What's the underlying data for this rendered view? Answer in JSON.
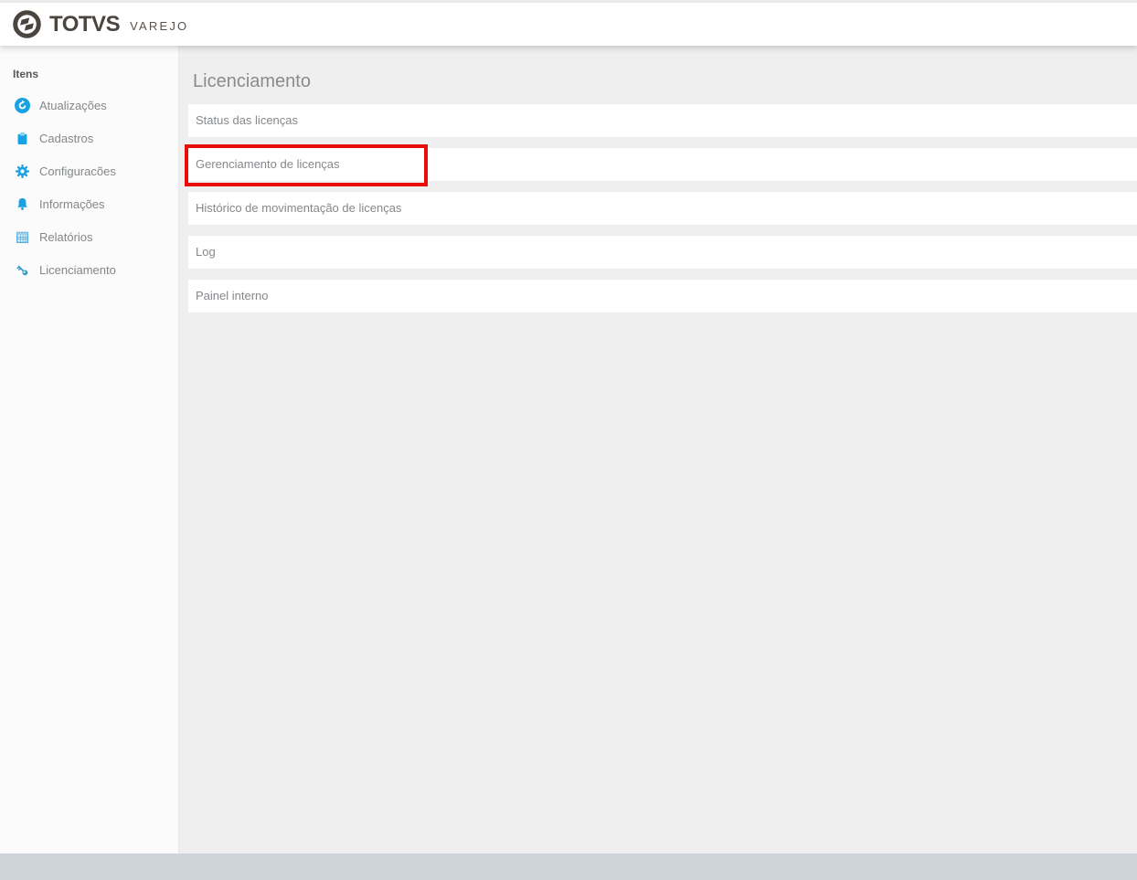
{
  "header": {
    "brand": "TOTVS",
    "brand_suffix": "VAREJO"
  },
  "sidebar": {
    "title": "Itens",
    "items": [
      {
        "label": "Atualizações",
        "icon": "sync-icon"
      },
      {
        "label": "Cadastros",
        "icon": "clipboard-icon"
      },
      {
        "label": "Configuracões",
        "icon": "gear-icon"
      },
      {
        "label": "Informações",
        "icon": "bell-icon"
      },
      {
        "label": "Relatórios",
        "icon": "table-icon"
      },
      {
        "label": "Licenciamento",
        "icon": "key-icon"
      }
    ]
  },
  "main": {
    "title": "Licenciamento",
    "menu_items": [
      {
        "label": "Status das licenças",
        "highlighted": false
      },
      {
        "label": "Gerenciamento de licenças",
        "highlighted": true
      },
      {
        "label": "Histórico de movimentação de licenças",
        "highlighted": false
      },
      {
        "label": "Log",
        "highlighted": false
      },
      {
        "label": "Painel interno",
        "highlighted": false
      }
    ]
  },
  "colors": {
    "accent_blue": "#18a2e3",
    "key_blue": "#2e9bcb",
    "brand_dark": "#4a453f",
    "highlight_red": "#ea0b0b",
    "content_bg": "#efefef",
    "sidebar_bg": "#fbfbfb",
    "footer_bar": "#ced2d9"
  }
}
